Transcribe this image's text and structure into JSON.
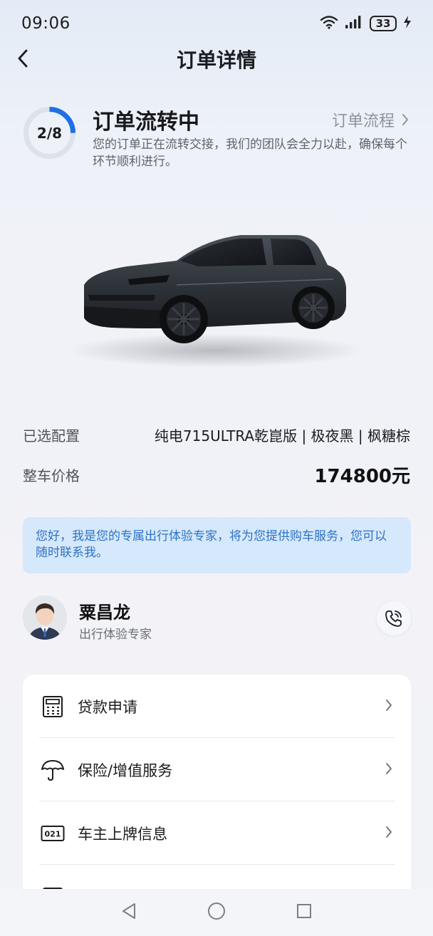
{
  "status_bar": {
    "time": "09:06",
    "battery": "33"
  },
  "header": {
    "title": "订单详情"
  },
  "order_status": {
    "progress_text": "2/8",
    "progress_fraction": 0.25,
    "title": "订单流转中",
    "flow_link": "订单流程",
    "description": "您的订单正在流转交接，我们的团队会全力以赴，确保每个环节顺利进行。"
  },
  "specs": {
    "config_label": "已选配置",
    "config_value": "纯电715ULTRA乾崑版 | 极夜黑 | 枫糖棕",
    "price_label": "整车价格",
    "price_value": "174800元"
  },
  "notice": {
    "text": "您好，我是您的专属出行体验专家，将为您提供购车服务，您可以随时联系我。"
  },
  "consultant": {
    "name": "粟昌龙",
    "role": "出行体验专家"
  },
  "menu": {
    "items": [
      {
        "label": "贷款申请",
        "icon": "calculator-icon"
      },
      {
        "label": "保险/增值服务",
        "icon": "umbrella-icon"
      },
      {
        "label": "车主上牌信息",
        "icon": "license-plate-icon"
      }
    ]
  },
  "colors": {
    "accent": "#1f6fe6",
    "notice_bg": "#d6e8fb",
    "notice_text": "#2d73c6"
  }
}
